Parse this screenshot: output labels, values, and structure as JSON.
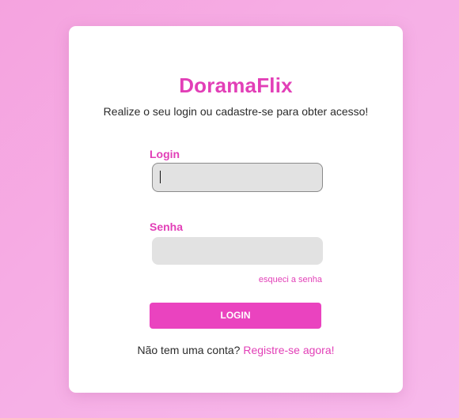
{
  "app": {
    "title": "DoramaFlix",
    "subtitle": "Realize o seu login ou cadastre-se para obter acesso!"
  },
  "form": {
    "login_label": "Login",
    "login_value": "",
    "senha_label": "Senha",
    "senha_value": "",
    "forgot_link": "esqueci a senha",
    "submit_label": "LOGIN"
  },
  "signup": {
    "prompt": "Não tem uma conta?",
    "link": "Registre-se agora!"
  },
  "colors": {
    "brand": "#e23fb7",
    "button": "#ea43bf",
    "background": "#f6b0e6"
  }
}
